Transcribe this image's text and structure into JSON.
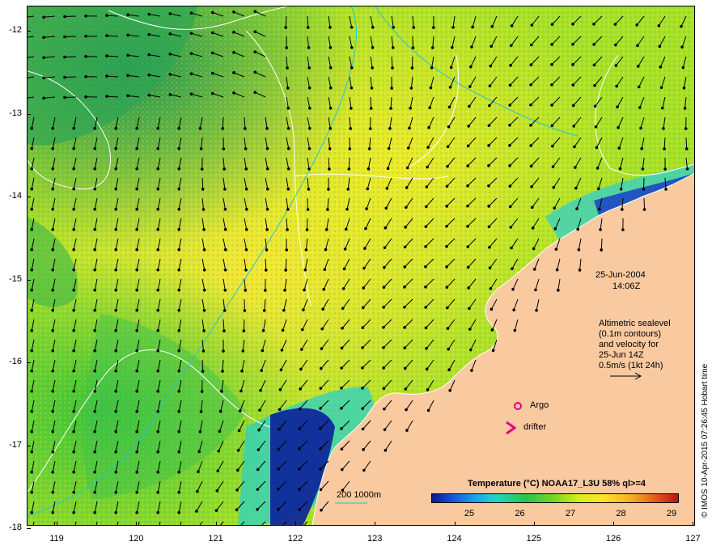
{
  "map": {
    "y_axis_labels": [
      "-12",
      "-13",
      "-14",
      "-15",
      "-16",
      "-17",
      "-18"
    ],
    "x_axis_labels": [
      "119",
      "120",
      "121",
      "122",
      "123",
      "124",
      "125",
      "126",
      "127"
    ],
    "date": "25-Jun-2004",
    "time": "14:06Z",
    "sealevel_note": [
      "Altimetric sealevel",
      "(0.1m contours)",
      "and velocity for",
      "25-Jun 14Z",
      "0.5m/s (1kt 24h)"
    ],
    "argo_label": "Argo",
    "drifter_label": "drifter",
    "depth_legend": "200  1000m",
    "colorbar": {
      "title": "Temperature (°C) NOAA17_L3U 58% ql>=4",
      "tick_labels": [
        "25",
        "26",
        "27",
        "28",
        "29"
      ]
    },
    "credit": "© IMOS 10-Apr-2015 07:26:45 Hobart time",
    "colors": {
      "land": "#f9c9a0",
      "contour": "#ffffff",
      "bathymetry": "#22c4d8",
      "argo_marker": "#e6007e",
      "drifter_marker": "#e6007e"
    },
    "icons": [
      "velocity-arrow-icon",
      "argo-float-icon",
      "drifter-icon"
    ]
  }
}
